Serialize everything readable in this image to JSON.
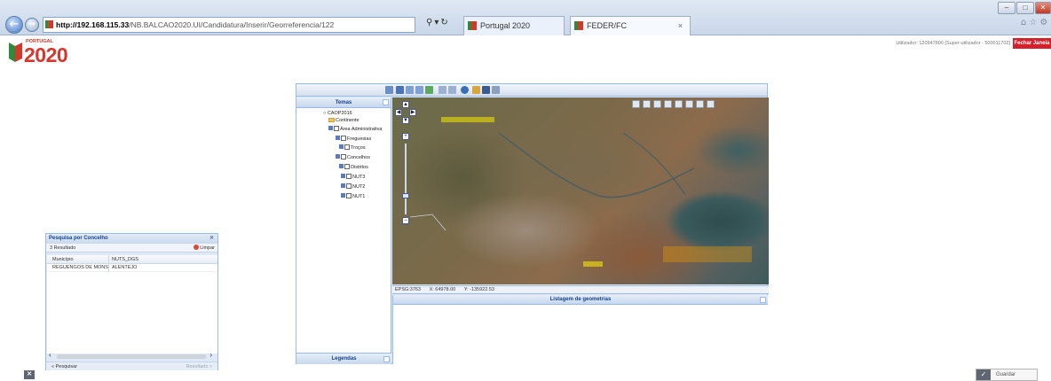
{
  "browser": {
    "address_host": "http://192.168.115.33",
    "address_path": "/NB.BALCAO2020.UI/Candidatura/Inserir/Georreferencia/122",
    "tabs": [
      {
        "label": "Portugal 2020"
      },
      {
        "label": "FEDER/FC"
      }
    ],
    "tab_close": "×"
  },
  "header": {
    "logo_country": "PORTUGAL",
    "logo_year": "2020",
    "user_info": "Utilizador: 120947800 [Super-utilizador - 500011702]",
    "close_window_label": "Fechar Janela"
  },
  "gis": {
    "layers_title": "Temas",
    "legend_title": "Legendas",
    "layers": [
      {
        "label": "CAOP2016",
        "kind": "root"
      },
      {
        "label": "Continente",
        "kind": "folder"
      },
      {
        "label": "Área Administrativa",
        "kind": "check"
      },
      {
        "label": "Freguesias",
        "kind": "layer"
      },
      {
        "label": "Troços",
        "kind": "layer"
      },
      {
        "label": "Concelhos",
        "kind": "layer"
      },
      {
        "label": "Distritos",
        "kind": "layer"
      },
      {
        "label": "NUT3",
        "kind": "layer"
      },
      {
        "label": "NUT2",
        "kind": "layer"
      },
      {
        "label": "NUT1",
        "kind": "layer"
      }
    ],
    "coords": {
      "epsg": "EPSG:3763",
      "x": "X: 64978.00",
      "y": "Y: -135922.53"
    },
    "geometry_list_title": "Listagem de geometrias"
  },
  "search": {
    "title": "Pesquisa por Concelho",
    "result_count": "3 Resultado",
    "clear_label": "Limpar",
    "columns": [
      "Município",
      "NUTS_DGS"
    ],
    "rows": [
      {
        "municipio": "REGUENGOS DE MONS...",
        "nuts": "ALENTEJO"
      }
    ],
    "search_link": "« Pesquisar",
    "result_link": "Resultado »"
  },
  "footer": {
    "save_label": "Guardar"
  },
  "colors": {
    "brand_red": "#d4372c",
    "panel_border": "#99bbe8",
    "map_label": "#f4e800"
  }
}
